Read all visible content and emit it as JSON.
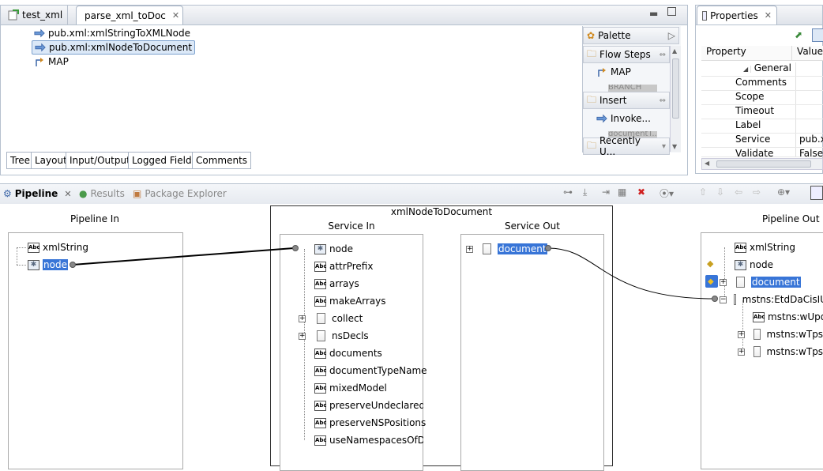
{
  "editor": {
    "tabs": [
      {
        "label": "test_xml"
      },
      {
        "label": "parse_xml_toDoc"
      }
    ],
    "steps": [
      {
        "label": "pub.xml:xmlStringToXMLNode"
      },
      {
        "label": "pub.xml:xmlNodeToDocument"
      },
      {
        "label": "MAP"
      }
    ],
    "bottom_tabs": [
      "Tree",
      "Layout",
      "Input/Output",
      "Logged Fields",
      "Comments"
    ]
  },
  "palette": {
    "title": "Palette",
    "drawers": [
      {
        "label": "Flow Steps",
        "items": [
          "MAP",
          "BRANCH"
        ]
      },
      {
        "label": "Insert",
        "items": [
          "Invoke...",
          "documentT..."
        ]
      },
      {
        "label": "Recently U..."
      }
    ]
  },
  "properties": {
    "tab_label": "Properties",
    "columns": [
      "Property",
      "Value"
    ],
    "group": "General",
    "rows": [
      {
        "name": "Comments",
        "value": ""
      },
      {
        "name": "Scope",
        "value": ""
      },
      {
        "name": "Timeout",
        "value": ""
      },
      {
        "name": "Label",
        "value": ""
      },
      {
        "name": "Service",
        "value": "pub.x"
      },
      {
        "name": "Validate input",
        "value": "False"
      }
    ]
  },
  "pipeline": {
    "tabs": [
      {
        "label": "Pipeline"
      },
      {
        "label": "Results"
      },
      {
        "label": "Package Explorer"
      }
    ],
    "service_name": "xmlNodeToDocument",
    "pipeline_in": {
      "title": "Pipeline In",
      "items": [
        "xmlString",
        "node"
      ]
    },
    "service_in": {
      "title": "Service In",
      "items": [
        "node",
        "attrPrefix",
        "arrays",
        "makeArrays",
        "collect",
        "nsDecls",
        "documents",
        "documentTypeName",
        "mixedModel",
        "preserveUndeclaredNS",
        "preserveNSPositions",
        "useNamespacesOfDoc"
      ]
    },
    "service_out": {
      "title": "Service Out",
      "items": [
        "document"
      ]
    },
    "pipeline_out": {
      "title": "Pipeline Out",
      "items": [
        "xmlString",
        "node",
        "document",
        "mstns:EtdDaCisIU",
        "mstns:wUpd",
        "mstns:wTpsr",
        "mstns:wTpsr"
      ]
    }
  }
}
